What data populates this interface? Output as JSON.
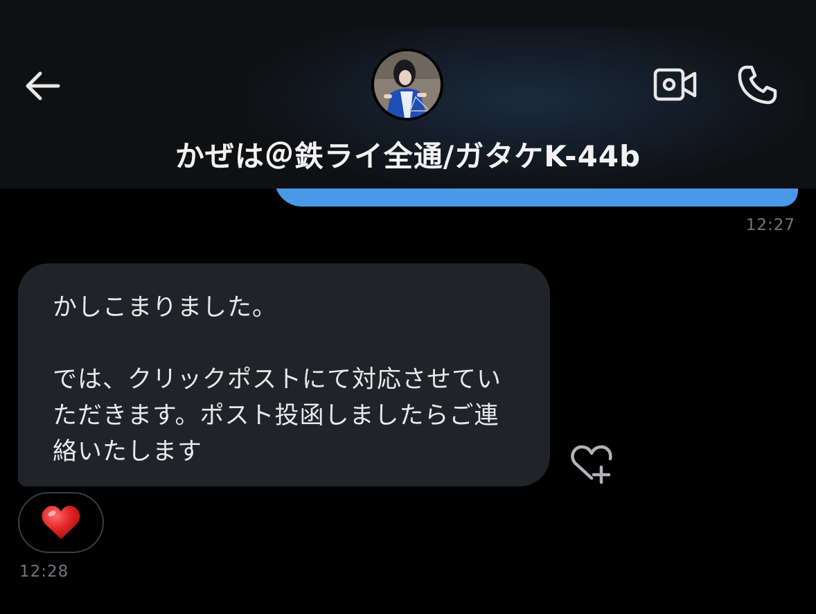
{
  "header": {
    "contact_name": "かぜは＠鉄ライ全通/ガタケK-44b",
    "back_icon": "arrow-left-icon",
    "video_icon": "video-camera-icon",
    "phone_icon": "phone-icon"
  },
  "messages": {
    "sent": {
      "timestamp": "12:27",
      "color": "#4a99e9"
    },
    "received": {
      "text": "かしこまりました。\n\nでは、クリックポストにて対応させていただきます。ポスト投函しましたらご連絡いたします",
      "timestamp": "12:28",
      "reaction": "❤️",
      "add_reaction_icon": "heart-plus-icon"
    }
  },
  "colors": {
    "background": "#000000",
    "header_bg": "#0f1012",
    "received_bubble": "#202327",
    "sent_bubble": "#4a99e9",
    "timestamp": "#72767b"
  }
}
